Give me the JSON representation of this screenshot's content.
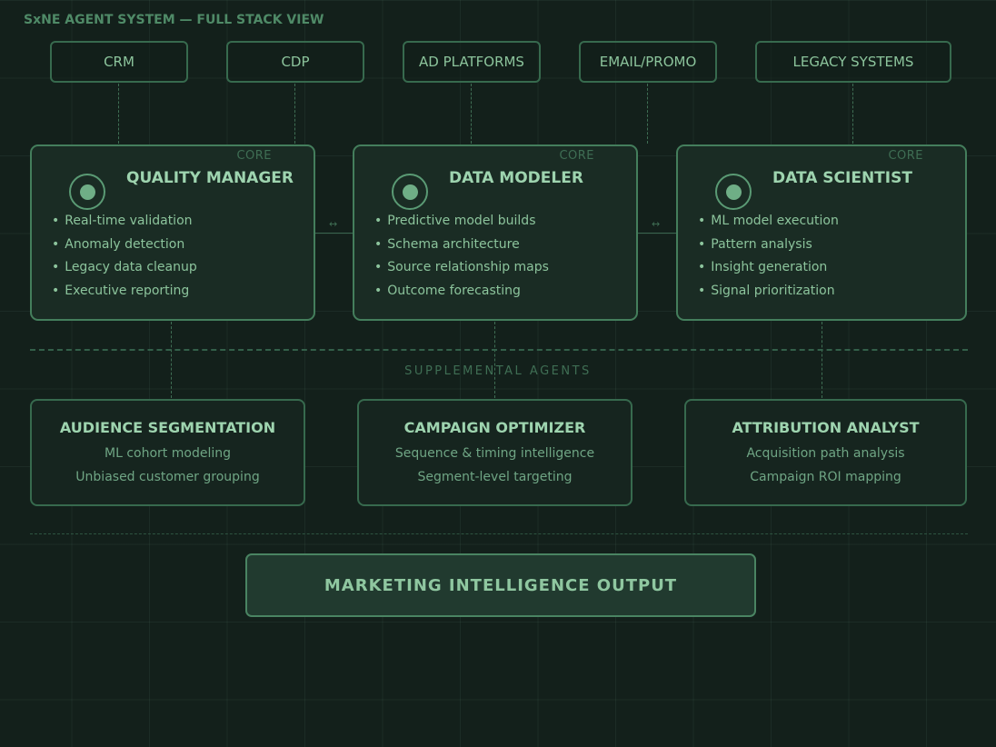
{
  "title": "SxNE AGENT SYSTEM — FULL STACK VIEW",
  "sources": [
    "CRM",
    "CDP",
    "AD PLATFORMS",
    "EMAIL/PROMO",
    "LEGACY SYSTEMS"
  ],
  "connector_arrow": "↔",
  "core_agents": [
    {
      "tag": "CORE",
      "title": "QUALITY MANAGER",
      "items": [
        "Real-time validation",
        "Anomaly detection",
        "Legacy data cleanup",
        "Executive reporting"
      ]
    },
    {
      "tag": "CORE",
      "title": "DATA MODELER",
      "items": [
        "Predictive model builds",
        "Schema architecture",
        "Source relationship maps",
        "Outcome forecasting"
      ]
    },
    {
      "tag": "CORE",
      "title": "DATA SCIENTIST",
      "items": [
        "ML model execution",
        "Pattern analysis",
        "Insight generation",
        "Signal prioritization"
      ]
    }
  ],
  "supplemental_label": "SUPPLEMENTAL AGENTS",
  "supplemental_agents": [
    {
      "title": "AUDIENCE SEGMENTATION",
      "lines": [
        "ML cohort modeling",
        "Unbiased customer grouping"
      ]
    },
    {
      "title": "CAMPAIGN OPTIMIZER",
      "lines": [
        "Sequence & timing intelligence",
        "Segment-level targeting"
      ]
    },
    {
      "title": "ATTRIBUTION ANALYST",
      "lines": [
        "Acquisition path analysis",
        "Campaign ROI mapping"
      ]
    }
  ],
  "output": "MARKETING INTELLIGENCE OUTPUT",
  "colors": {
    "background": "#13201b",
    "accent": "#6fae86",
    "text": "#8fc7a0",
    "border": "#447e5c"
  }
}
